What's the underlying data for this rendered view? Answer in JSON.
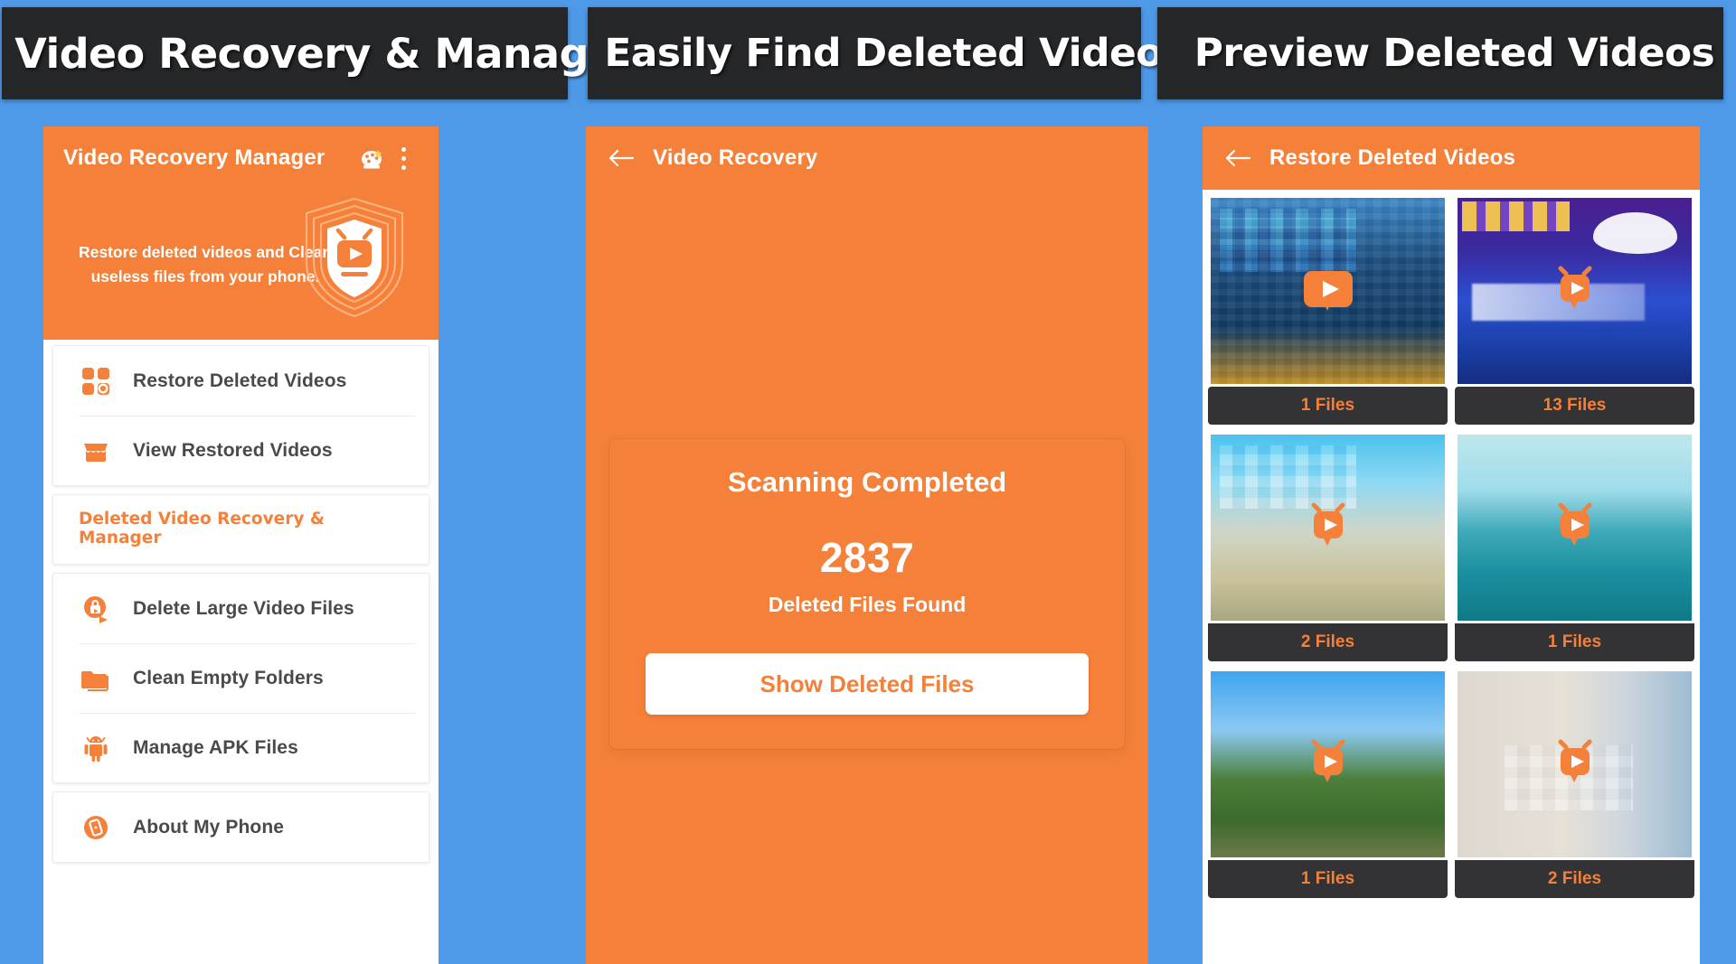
{
  "theme": {
    "background_blue": "#4f9ae8",
    "banner_dark": "#262729",
    "accent_orange": "#f4803a",
    "caption_dark": "#333335",
    "text_grey": "#4a4a4a"
  },
  "panels": [
    {
      "banner_title": "Video Recovery & Manager",
      "appbar": {
        "title": "Video Recovery Manager",
        "rate_icon": "rate-us-icon",
        "menu_icon": "overflow-menu-icon"
      },
      "hero": {
        "tagline": "Restore deleted videos and Clean useless files from your phone.",
        "logo_icon": "shield-tv-logo-icon"
      },
      "menu_groups": [
        {
          "type": "list",
          "items": [
            {
              "label": "Restore Deleted Videos",
              "icon": "grid-search-icon"
            },
            {
              "label": "View Restored Videos",
              "icon": "archive-box-icon"
            }
          ]
        },
        {
          "type": "section",
          "title": "Deleted Video Recovery & Manager"
        },
        {
          "type": "list",
          "items": [
            {
              "label": "Delete Large Video Files",
              "icon": "video-lock-icon"
            },
            {
              "label": "Clean Empty Folders",
              "icon": "folder-icon"
            },
            {
              "label": "Manage APK Files",
              "icon": "android-icon"
            }
          ]
        },
        {
          "type": "list",
          "items": [
            {
              "label": "About My Phone",
              "icon": "phone-info-icon"
            }
          ]
        }
      ]
    },
    {
      "banner_title": "Easily Find Deleted Videos",
      "appbar": {
        "title": "Video Recovery",
        "back_icon": "back-arrow-icon"
      },
      "scan": {
        "title": "Scanning Completed",
        "count": "2837",
        "subtitle": "Deleted Files Found",
        "button_label": "Show Deleted Files"
      }
    },
    {
      "banner_title": "Preview Deleted Videos",
      "appbar": {
        "title": "Restore Deleted Videos",
        "back_icon": "back-arrow-icon"
      },
      "tiles": [
        {
          "caption": "1 Files",
          "scene": "aquarium",
          "play_icon": "play-badge-icon"
        },
        {
          "caption": "13 Files",
          "scene": "night",
          "play_icon": "play-badge-icon"
        },
        {
          "caption": "2 Files",
          "scene": "fountain",
          "play_icon": "play-badge-icon"
        },
        {
          "caption": "1 Files",
          "scene": "sea",
          "play_icon": "play-badge-icon"
        },
        {
          "caption": "1 Files",
          "scene": "garden",
          "play_icon": "play-badge-icon"
        },
        {
          "caption": "2 Files",
          "scene": "street",
          "play_icon": "play-badge-icon"
        }
      ]
    }
  ]
}
